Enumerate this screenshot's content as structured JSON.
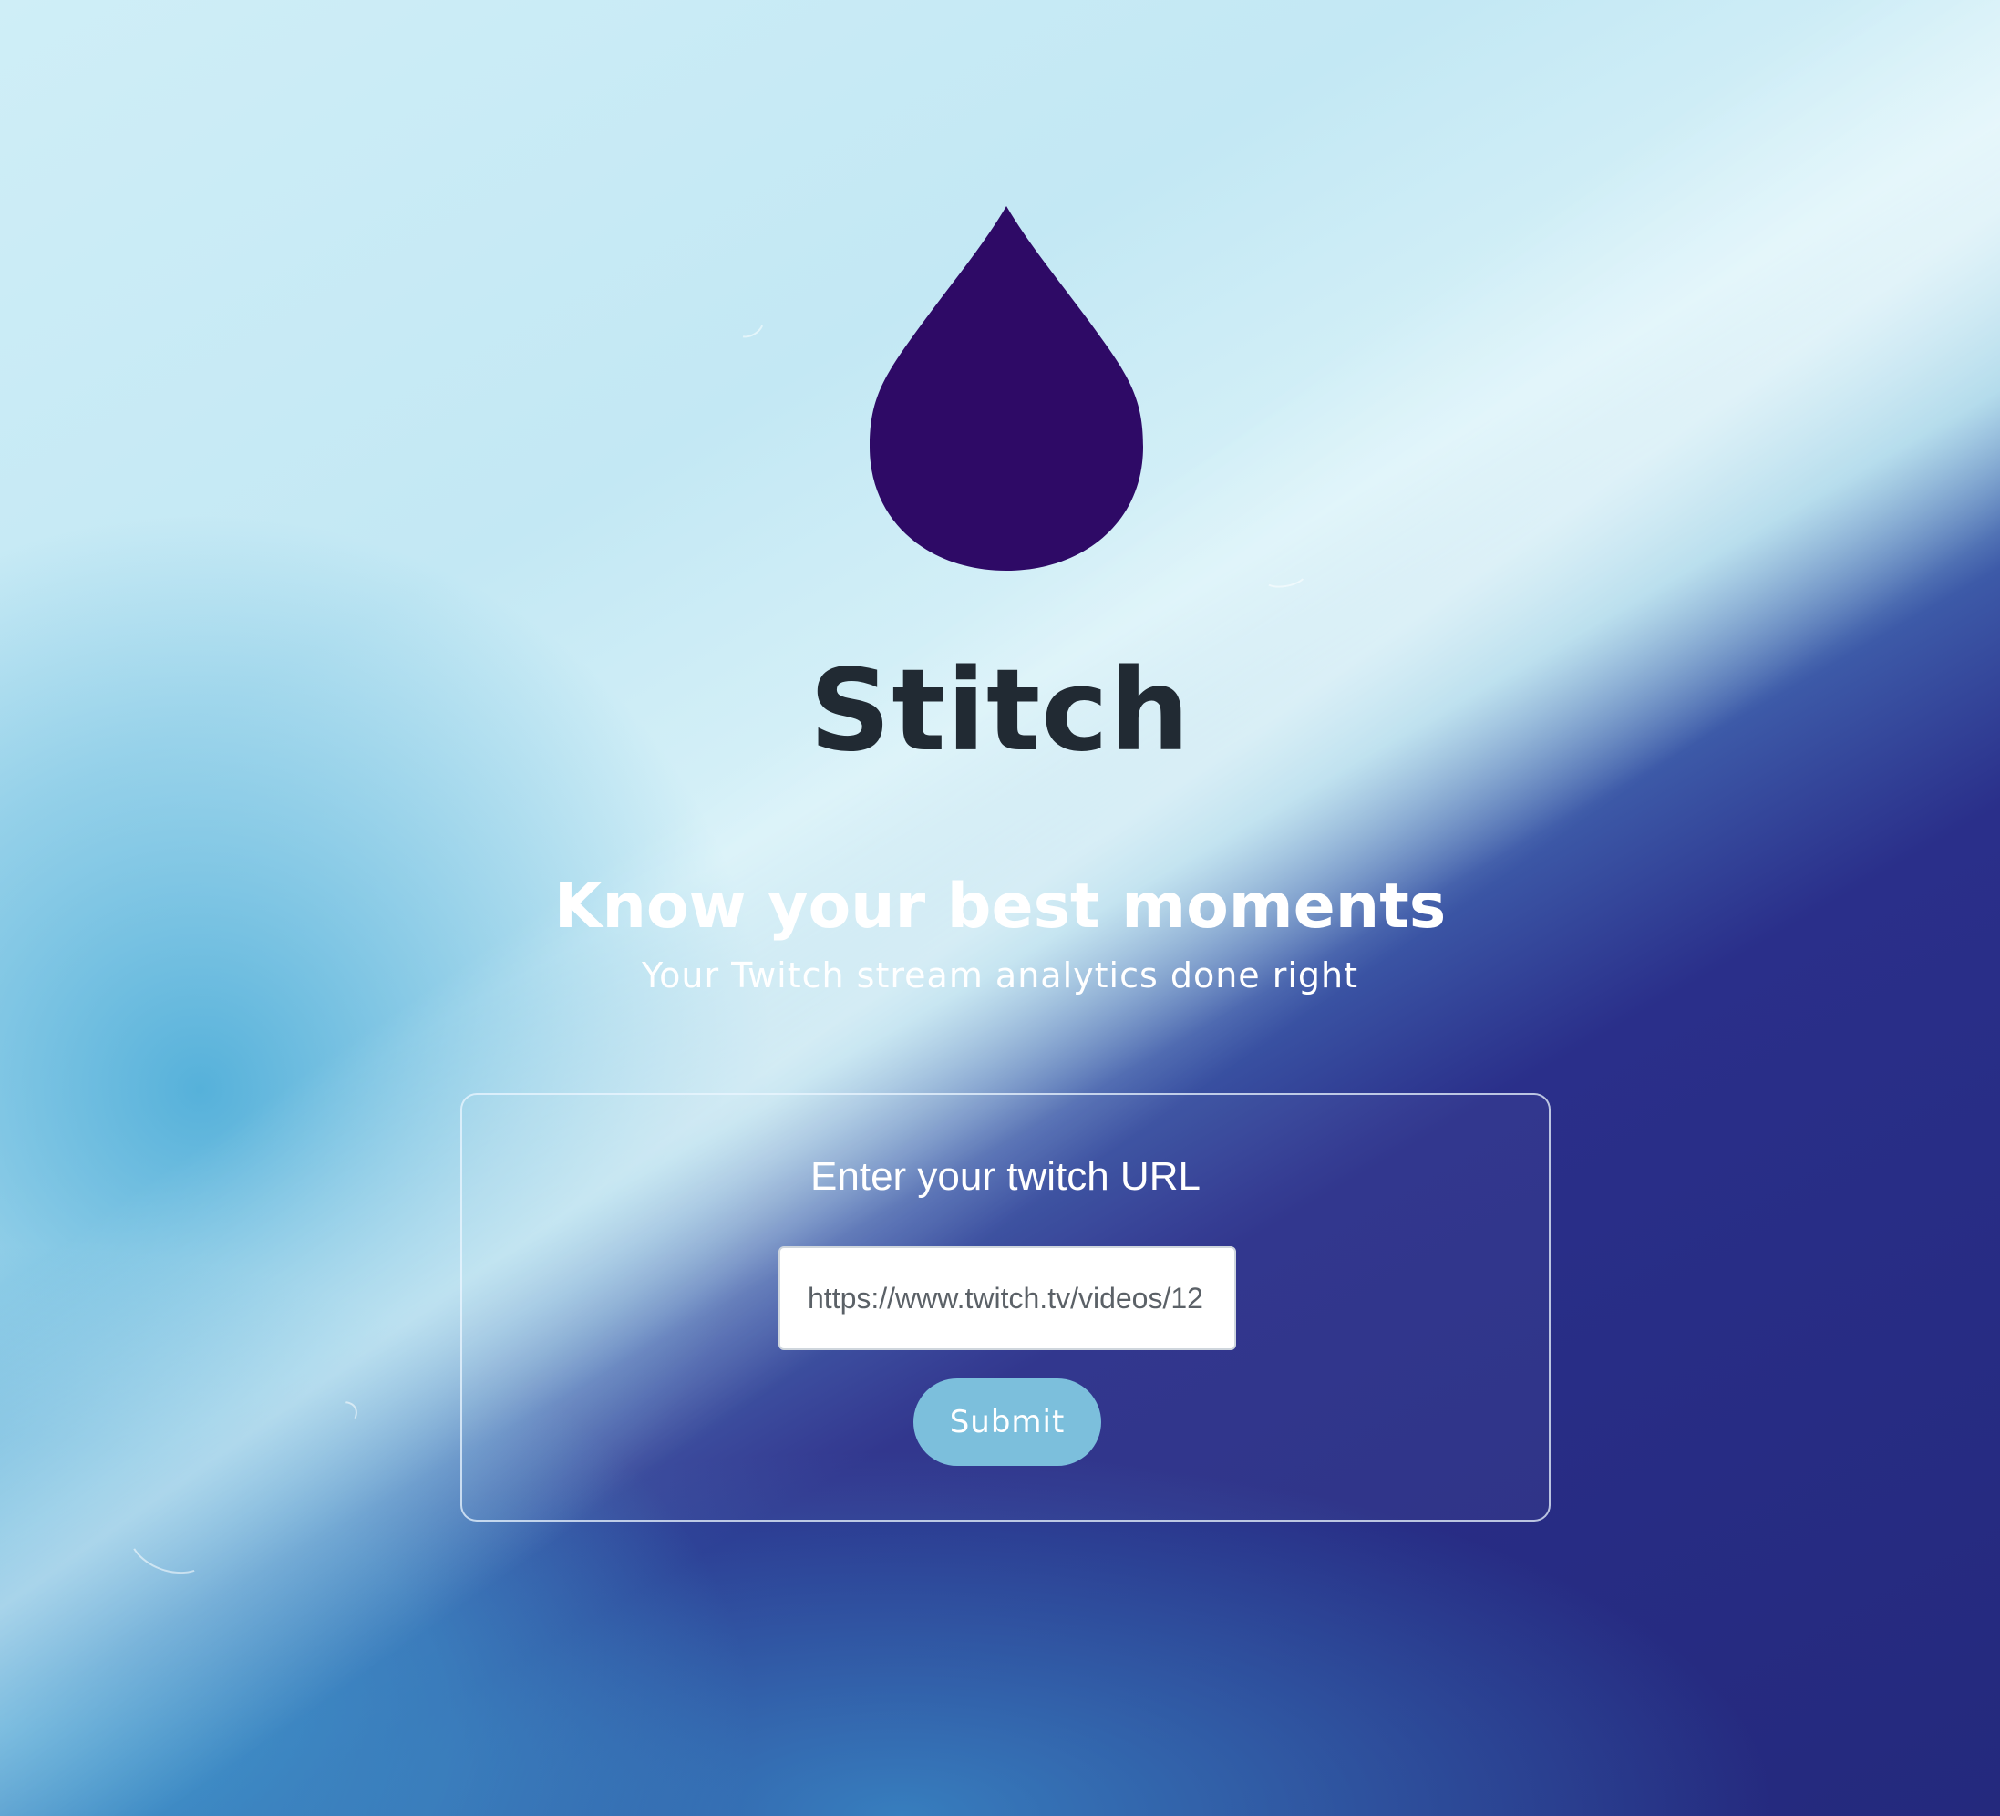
{
  "brand": {
    "name": "Stitch",
    "logo_icon": "droplet-icon",
    "logo_color": "#2e0a66"
  },
  "hero": {
    "headline": "Know your best moments",
    "subheadline": "Your Twitch stream analytics done right"
  },
  "form": {
    "title": "Enter your twitch URL",
    "url_placeholder": "https://www.twitch.tv/videos/12",
    "submit_label": "Submit",
    "submit_color": "#7cbfdc"
  },
  "colors": {
    "light_sky": "#cfeef7",
    "deep_navy": "#24297d",
    "mid_blue": "#4aa9d6",
    "brand_text": "#212a33"
  }
}
